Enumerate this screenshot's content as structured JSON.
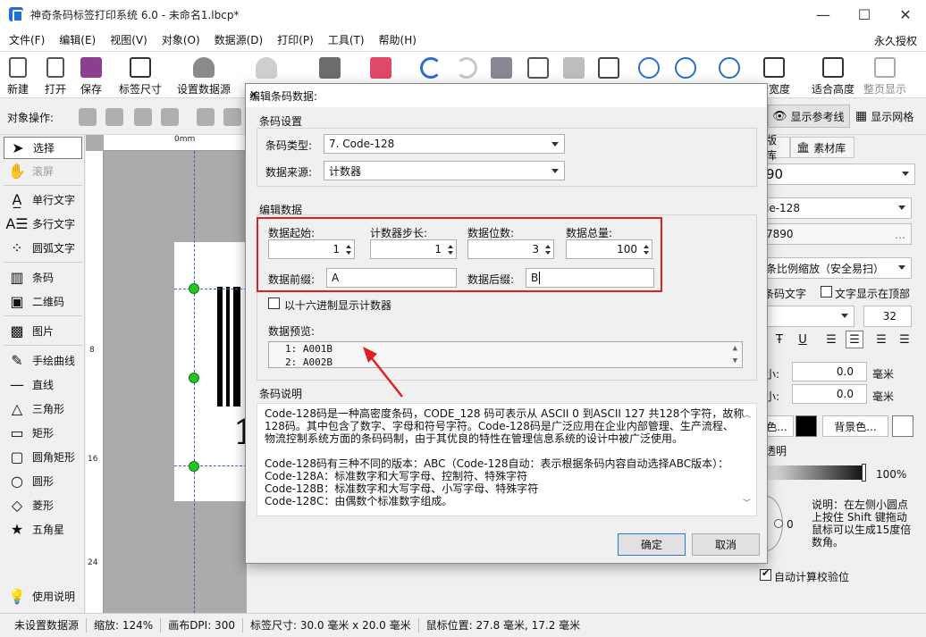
{
  "window": {
    "title": "神奇条码标签打印系统 6.0 - 未命名1.lbcp*",
    "minimize": "—",
    "maximize": "☐",
    "close": "✕"
  },
  "menu": [
    "文件(F)",
    "编辑(E)",
    "视图(V)",
    "对象(O)",
    "数据源(D)",
    "打印(P)",
    "工具(T)",
    "帮助(H)"
  ],
  "menu_right": "永久授权",
  "toolbar": {
    "new": "新建",
    "open": "打开",
    "save": "保存",
    "label_size": "标签尺寸",
    "set_datasource": "设置数据源",
    "fit_width": "合宽度",
    "fit_height": "适合高度",
    "fit_page": "整页显示"
  },
  "objbar": {
    "label": "对象操作:",
    "show_guides": "显示参考线",
    "show_grid": "显示网格"
  },
  "left_tools": {
    "select": "选择",
    "scroll": "滚屏",
    "single_text": "单行文字",
    "multi_text": "多行文字",
    "arc_text": "圆弧文字",
    "barcode": "条码",
    "qrcode": "二维码",
    "image": "图片",
    "freehand": "手绘曲线",
    "line": "直线",
    "triangle": "三角形",
    "rectangle": "矩形",
    "round_rect": "圆角矩形",
    "circle": "圆形",
    "diamond": "菱形",
    "star": "五角星",
    "help": "使用说明"
  },
  "ruler": {
    "top_zero": "0mm",
    "left_8": "8",
    "left_16": "16",
    "left_24": "24"
  },
  "canvas_text": "1",
  "right_panel": {
    "tab_template": "版库",
    "tab_material": "素材库",
    "field_90": "90",
    "field_type": "le-128",
    "field_data": "7890",
    "scale_mode": "条比例缩放（安全易扫）",
    "barcode_text": "条码文字",
    "text_top": "文字显示在顶部",
    "font_size": "32",
    "size_w": "小:",
    "size_w_val": "0.0",
    "size_h": "小:",
    "size_h_val": "0.0",
    "unit_mm": "毫米",
    "unit_mm2": "毫米",
    "fg_color": "色...",
    "bg_color": "背景色...",
    "transparent": "透明",
    "opacity": "100%",
    "rotation": "0",
    "note": "说明：在左侧小圆点上按住 Shift 键拖动鼠标可以生成15度倍数角。",
    "auto_check": "自动计算校验位"
  },
  "status": {
    "datasource": "未设置数据源",
    "zoom": "缩放: 124%",
    "dpi": "画布DPI: 300",
    "label_size": "标签尺寸: 30.0 毫米 x 20.0 毫米",
    "cursor": "鼠标位置: 27.8 毫米, 17.2 毫米"
  },
  "dialog": {
    "title": "编辑条码数据:",
    "group_settings": "条码设置",
    "type_label": "条码类型:",
    "type_value": "7. Code-128",
    "source_label": "数据来源:",
    "source_value": "计数器",
    "group_data": "编辑数据",
    "start_label": "数据起始:",
    "start_value": "1",
    "step_label": "计数器步长:",
    "step_value": "1",
    "digits_label": "数据位数:",
    "digits_value": "3",
    "total_label": "数据总量:",
    "total_value": "100",
    "prefix_label": "数据前缀:",
    "prefix_value": "A",
    "suffix_label": "数据后缀:",
    "suffix_value": "B",
    "hex_label": "以十六进制显示计数器",
    "preview_label": "数据预览:",
    "preview_lines": [
      "1:    A001B",
      "2:    A002B"
    ],
    "group_desc": "条码说明",
    "desc_lines": [
      "Code-128码是一种高密度条码，CODE_128 码可表示从 ASCII 0 到ASCII 127 共128个字符，故称",
      "128码。其中包含了数字、字母和符号字符。Code-128码是广泛应用在企业内部管理、生产流程、",
      "物流控制系统方面的条码码制，由于其优良的特性在管理信息系统的设计中被广泛使用。",
      "",
      "Code-128码有三种不同的版本：ABC（Code-128自动：表示根据条码内容自动选择ABC版本）：",
      "Code-128A：标准数字和大写字母、控制符、特殊字符",
      "Code-128B：标准数字和大写字母、小写字母、特殊字符",
      "Code-128C：由偶数个标准数字组成。"
    ],
    "ok": "确定",
    "cancel": "取消"
  },
  "colors": {
    "accent_red": "#e02020",
    "handle_green": "#23c423",
    "guide_blue": "#3a5fd0"
  }
}
